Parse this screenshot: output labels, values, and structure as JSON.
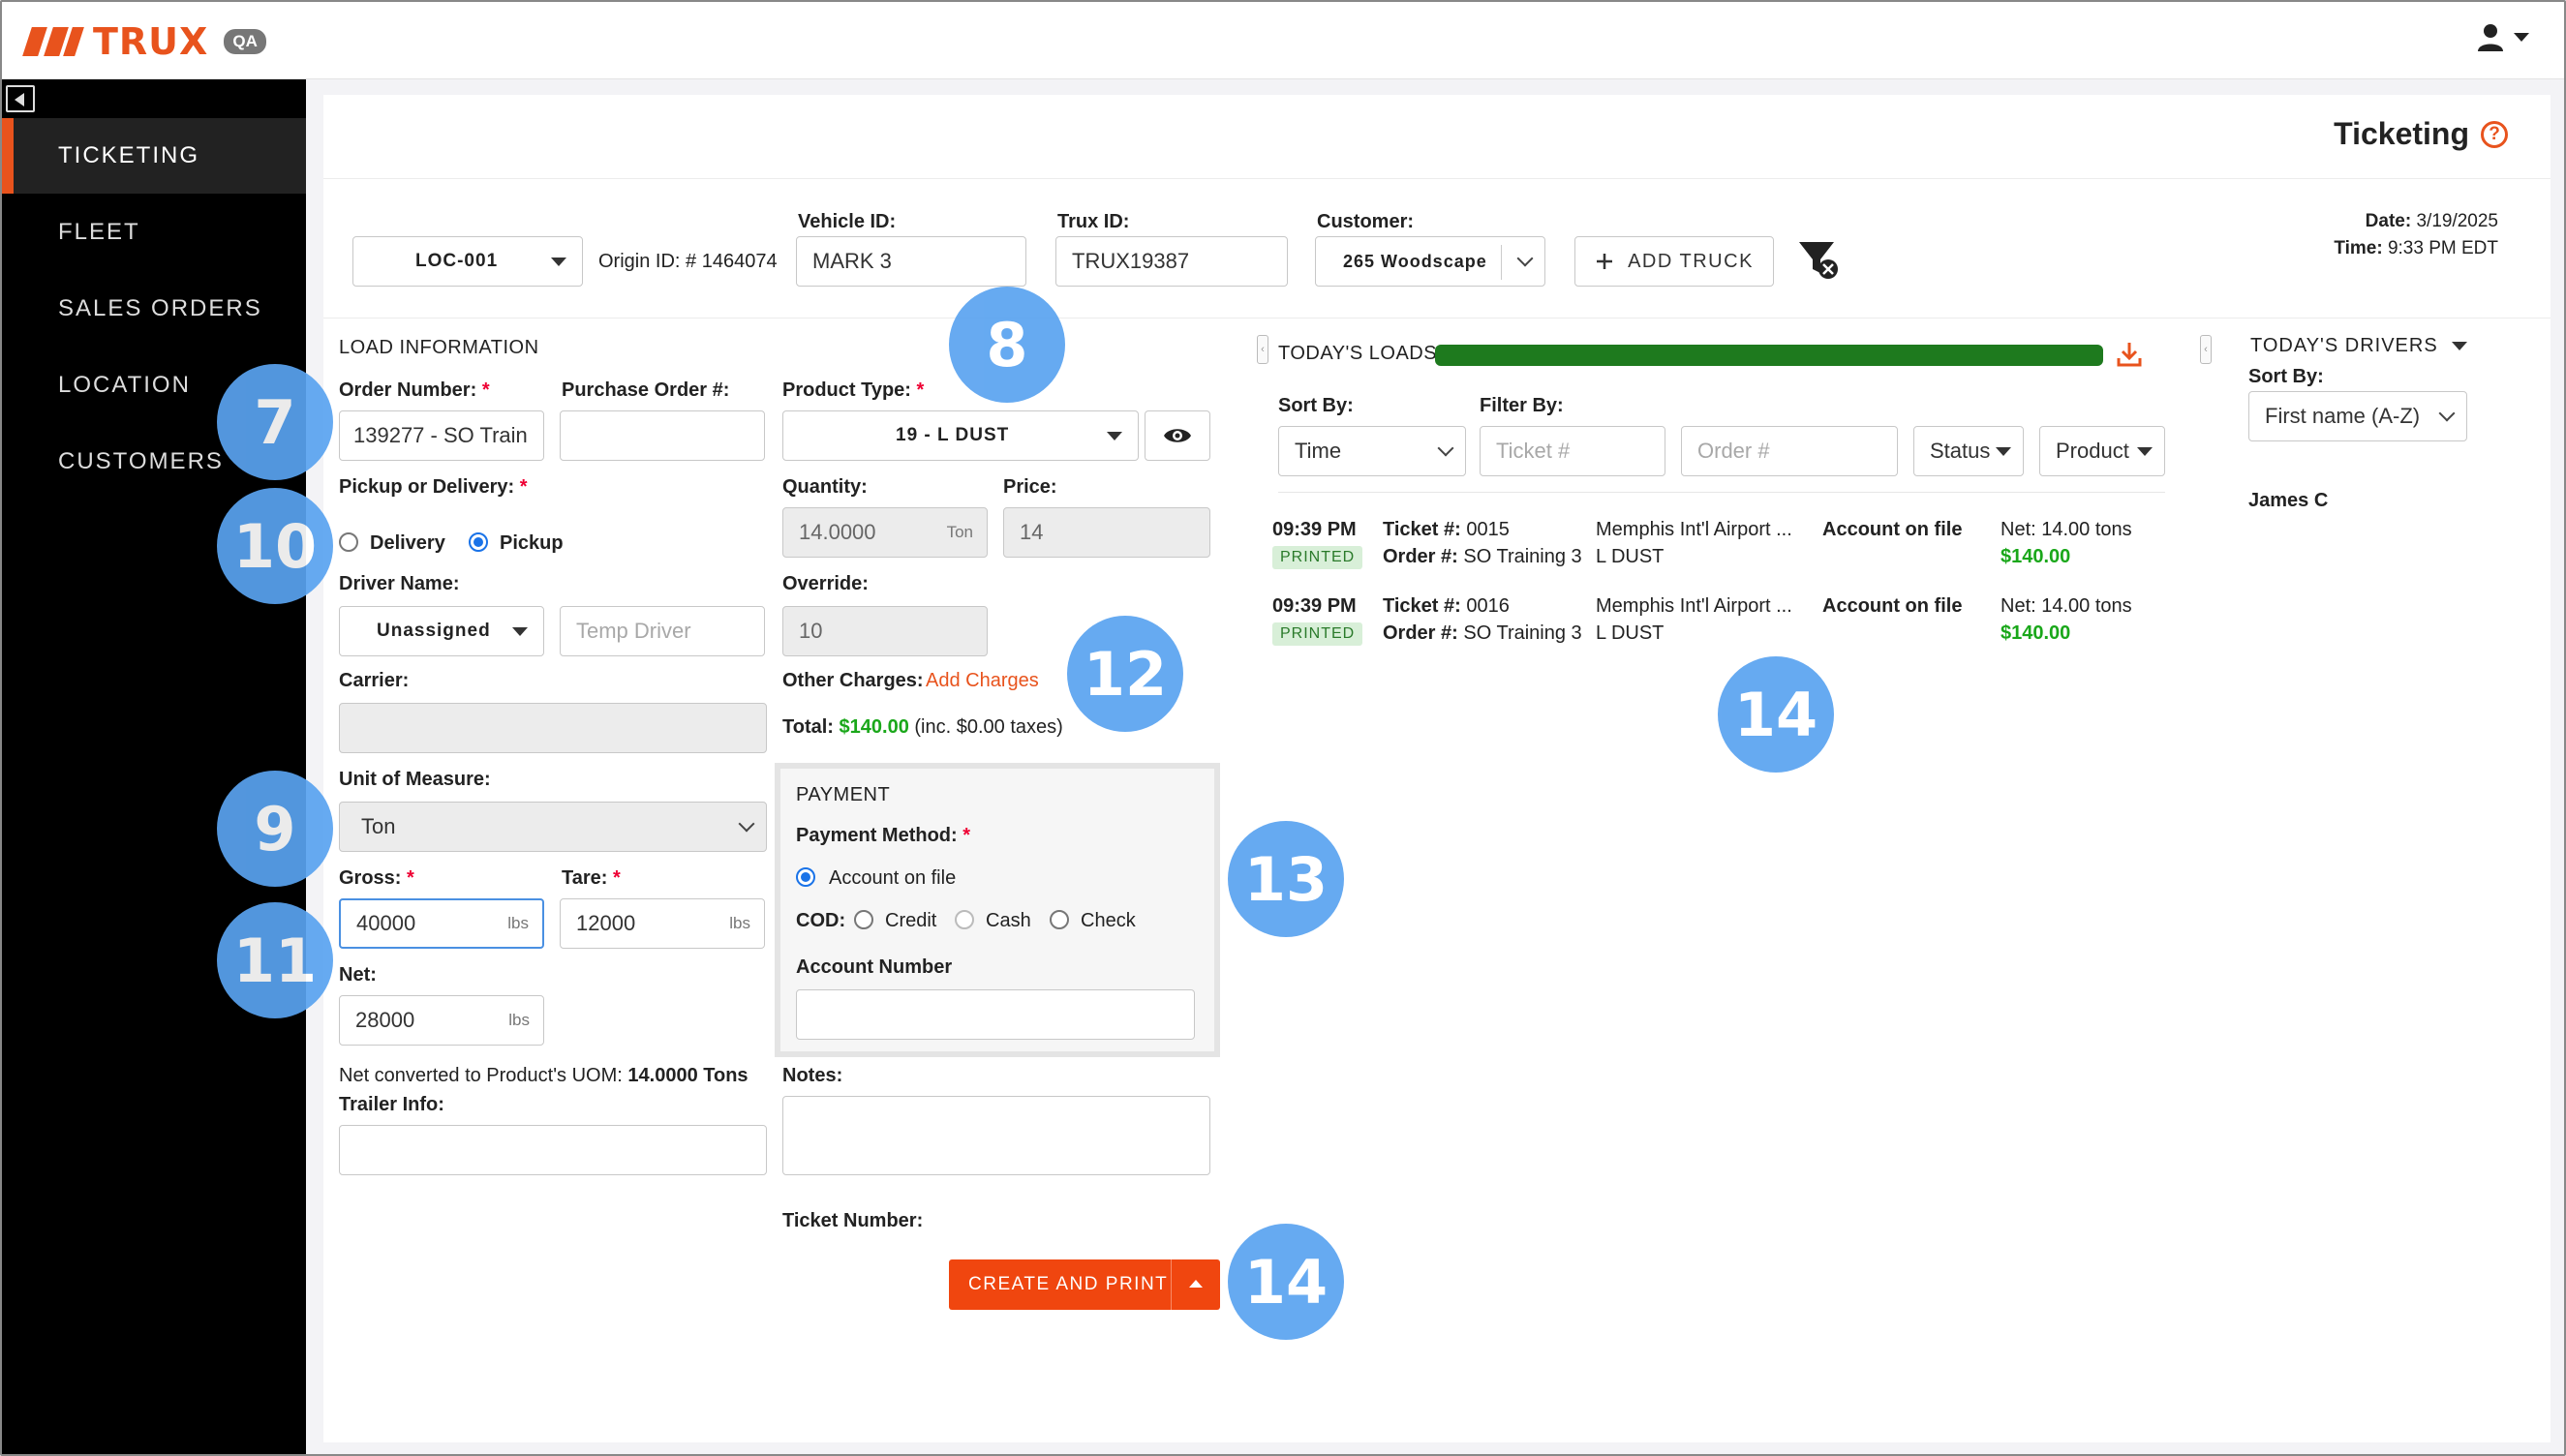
{
  "app": {
    "brand": "TRUX",
    "env_badge": "QA"
  },
  "sidebar": {
    "items": [
      {
        "label": "TICKETING"
      },
      {
        "label": "FLEET"
      },
      {
        "label": "SALES ORDERS"
      },
      {
        "label": "LOCATION"
      },
      {
        "label": "CUSTOMERS"
      }
    ]
  },
  "page": {
    "title": "Ticketing"
  },
  "header": {
    "location": "LOC-001",
    "origin_id": "Origin ID: # 1464074",
    "vehicle_label": "Vehicle ID:",
    "vehicle_value": "MARK 3",
    "trux_label": "Trux ID:",
    "trux_value": "TRUX19387",
    "customer_label": "Customer:",
    "customer_value": "265 Woodscape",
    "add_truck": "ADD TRUCK",
    "date_label": "Date:",
    "date_value": "3/19/2025",
    "time_label": "Time:",
    "time_value": "9:33 PM EDT"
  },
  "load": {
    "section": "LOAD INFORMATION",
    "order_number_label": "Order Number:",
    "order_number_value": "139277 - SO Train",
    "po_label": "Purchase Order #:",
    "po_value": "",
    "pickup_delivery_label": "Pickup or Delivery:",
    "delivery": "Delivery",
    "pickup": "Pickup",
    "driver_label": "Driver Name:",
    "driver_value": "Unassigned",
    "temp_driver_placeholder": "Temp Driver",
    "carrier_label": "Carrier:",
    "uom_label": "Unit of Measure:",
    "uom_value": "Ton",
    "gross_label": "Gross:",
    "gross_value": "40000",
    "tare_label": "Tare:",
    "tare_value": "12000",
    "unit_lbs": "lbs",
    "net_label": "Net:",
    "net_value": "28000",
    "net_converted_text": "Net converted to Product's UOM:",
    "net_converted_value": "14.0000 Tons",
    "trailer_label": "Trailer Info:",
    "product_type_label": "Product Type:",
    "product_type_value": "19 - L DUST",
    "quantity_label": "Quantity:",
    "quantity_value": "14.0000",
    "quantity_unit": "Ton",
    "price_label": "Price:",
    "price_value": "14",
    "override_label": "Override:",
    "override_value": "10",
    "other_charges_label": "Other Charges:",
    "add_charges": "Add Charges",
    "total_label": "Total:",
    "total_value": "$140.00",
    "total_tax": "(inc. $0.00 taxes)",
    "notes_label": "Notes:",
    "ticket_number_label": "Ticket Number:",
    "create_print": "CREATE AND PRINT"
  },
  "payment": {
    "section": "PAYMENT",
    "method_label": "Payment Method:",
    "account_on_file": "Account on file",
    "cod_label": "COD:",
    "credit": "Credit",
    "cash": "Cash",
    "check": "Check",
    "account_number_label": "Account Number"
  },
  "loads": {
    "title": "TODAY'S LOADS",
    "progress_percent": 100,
    "sort_label": "Sort By:",
    "sort_value": "Time",
    "filter_label": "Filter By:",
    "ticket_placeholder": "Ticket #",
    "order_placeholder": "Order #",
    "status": "Status",
    "product": "Product",
    "rows": [
      {
        "time": "09:39 PM",
        "status": "PRINTED",
        "ticket_label": "Ticket #:",
        "ticket": "0015",
        "order_label": "Order #:",
        "order": "SO Training 3",
        "location": "Memphis Int'l Airport ...",
        "product": "L DUST",
        "payment": "Account on file",
        "net": "Net: 14.00 tons",
        "amount": "$140.00"
      },
      {
        "time": "09:39 PM",
        "status": "PRINTED",
        "ticket_label": "Ticket #:",
        "ticket": "0016",
        "order_label": "Order #:",
        "order": "SO Training 3",
        "location": "Memphis Int'l Airport ...",
        "product": "L DUST",
        "payment": "Account on file",
        "net": "Net: 14.00 tons",
        "amount": "$140.00"
      }
    ]
  },
  "drivers": {
    "title": "TODAY'S DRIVERS",
    "sort_label": "Sort By:",
    "sort_value": "First name (A-Z)",
    "items": [
      "James C"
    ]
  },
  "badges": [
    "7",
    "8",
    "10",
    "9",
    "11",
    "12",
    "13",
    "14",
    "14"
  ],
  "colors": {
    "accent": "#e8531d",
    "primary_button": "#f0460f",
    "badge": "#5aa3f0",
    "progress": "#1e7a1e",
    "money": "#1aa71a"
  }
}
